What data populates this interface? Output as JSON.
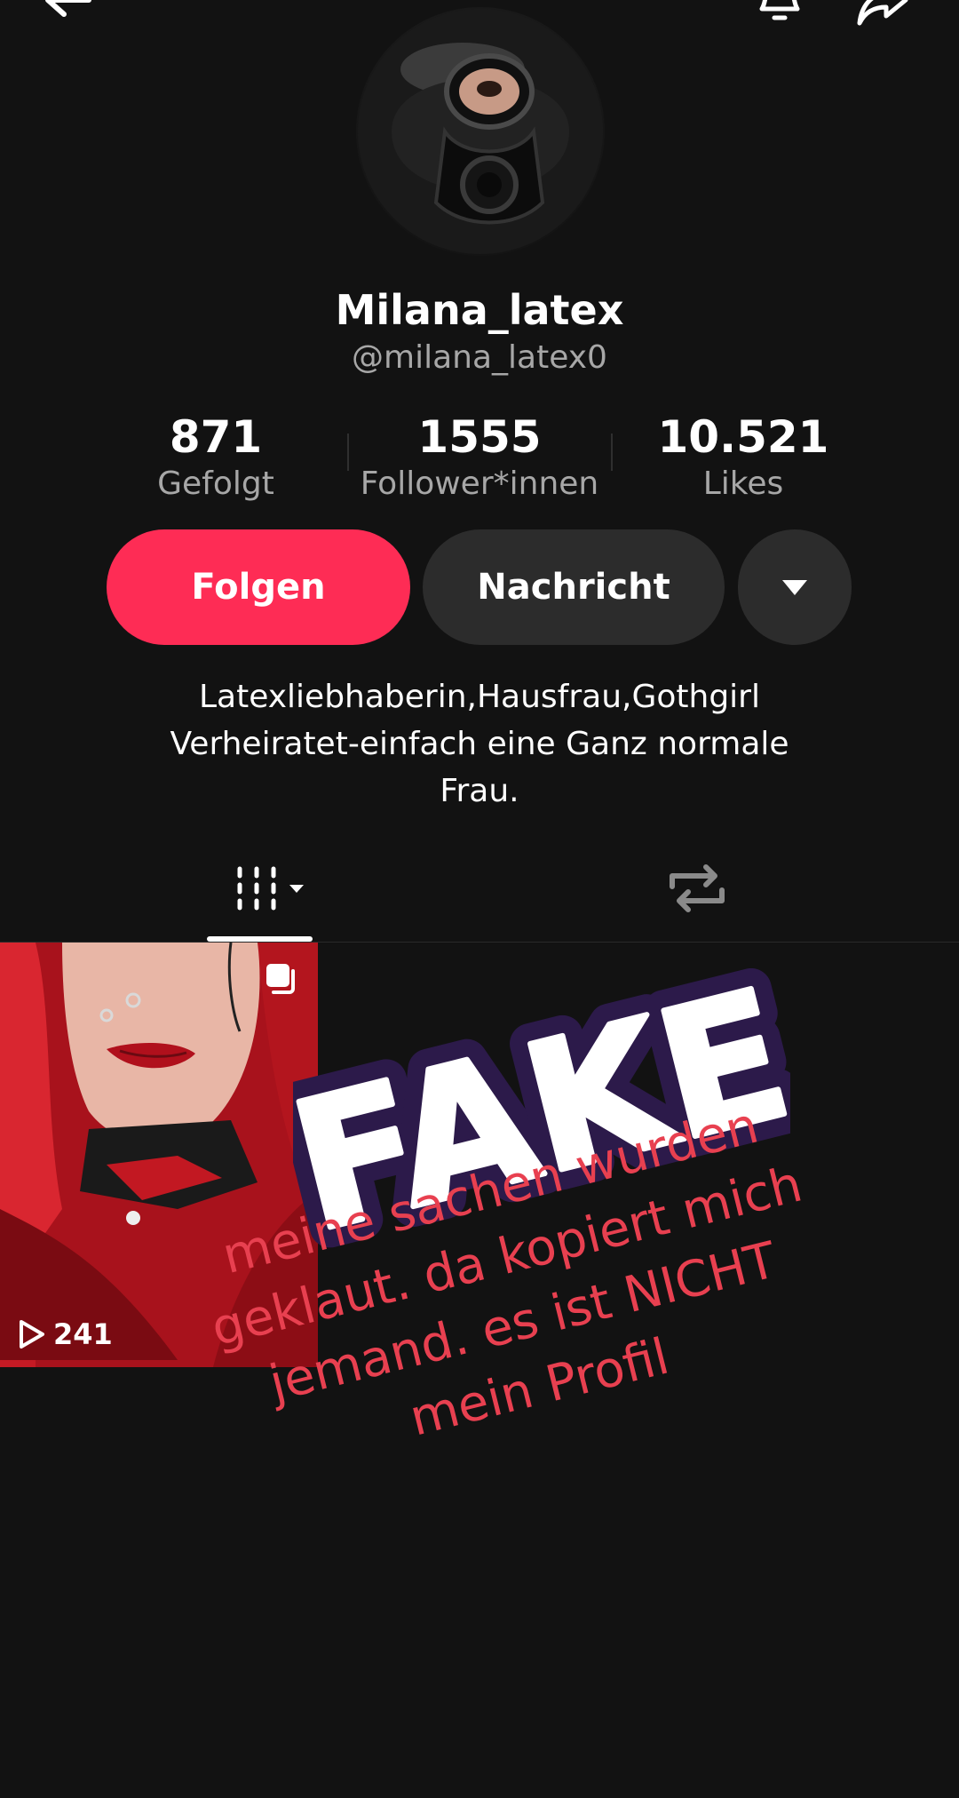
{
  "profile": {
    "display_name": "Milana_latex",
    "handle": "@milana_latex0"
  },
  "stats": [
    {
      "value": "871",
      "label": "Gefolgt"
    },
    {
      "value": "1555",
      "label": "Follower*innen"
    },
    {
      "value": "10.521",
      "label": "Likes"
    }
  ],
  "actions": {
    "follow_label": "Folgen",
    "message_label": "Nachricht"
  },
  "bio": [
    "Latexliebhaberin,Hausfrau,Gothgirl",
    "Verheiratet-einfach eine Ganz normale",
    "Frau."
  ],
  "videos": [
    {
      "views": "241"
    }
  ],
  "overlay": {
    "sticker_text": "FAKE",
    "lines": [
      "meine sachen wurden",
      "geklaut. da kopiert mich",
      "jemand. es ist NICHT",
      "mein Profil"
    ]
  },
  "colors": {
    "background": "#121212",
    "accent": "#fe2c55",
    "button_secondary": "#2c2c2c",
    "muted_text": "#a7a7a7",
    "overlay_text": "#e84050",
    "sticker_outline": "#2c1a4a"
  },
  "icons": {
    "back": "arrow-left-icon",
    "notifications": "bell-icon",
    "share": "share-arrow-icon",
    "dropdown": "triangle-down-icon",
    "videos_tab": "grid-lines-icon",
    "reposts_tab": "repost-icon",
    "play": "play-icon",
    "multi": "multi-photo-icon"
  }
}
